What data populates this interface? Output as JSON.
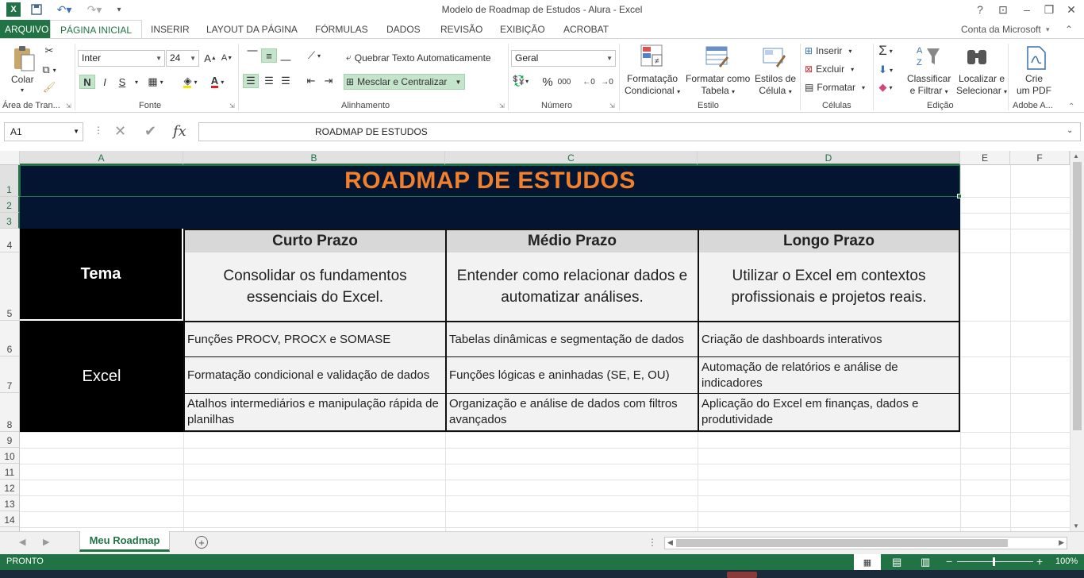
{
  "window": {
    "title": "Modelo de Roadmap de Estudos - Alura - Excel",
    "help": "?",
    "account": "Conta da Microsoft"
  },
  "tabs": [
    "ARQUIVO",
    "PÁGINA INICIAL",
    "INSERIR",
    "LAYOUT DA PÁGINA",
    "FÓRMULAS",
    "DADOS",
    "REVISÃO",
    "EXIBIÇÃO",
    "ACROBAT"
  ],
  "ribbon": {
    "clipboard": {
      "paste": "Colar",
      "group": "Área de Tran..."
    },
    "font": {
      "name": "Inter",
      "size": "24",
      "bold": "N",
      "italic": "I",
      "underline": "S",
      "group": "Fonte"
    },
    "alignment": {
      "wrap": "Quebrar Texto Automaticamente",
      "merge": "Mesclar e Centralizar",
      "group": "Alinhamento"
    },
    "number": {
      "format": "Geral",
      "percent": "%",
      "thousands": "000",
      "group": "Número"
    },
    "styles": {
      "cond1": "Formatação",
      "cond2": "Condicional",
      "table1": "Formatar como",
      "table2": "Tabela",
      "cell1": "Estilos de",
      "cell2": "Célula",
      "group": "Estilo"
    },
    "cells": {
      "insert": "Inserir",
      "delete": "Excluir",
      "format": "Formatar",
      "group": "Células"
    },
    "editing": {
      "sort1": "Classificar",
      "sort2": "e Filtrar",
      "find1": "Localizar e",
      "find2": "Selecionar",
      "group": "Edição"
    },
    "adobe": {
      "pdf1": "Crie",
      "pdf2": "um PDF",
      "group": "Adobe A..."
    }
  },
  "formula_bar": {
    "name_box": "A1",
    "fx": "fx",
    "content": "ROADMAP DE ESTUDOS"
  },
  "columns": [
    "A",
    "B",
    "C",
    "D",
    "E",
    "F"
  ],
  "rows": [
    "1",
    "2",
    "3",
    "4",
    "5",
    "6",
    "7",
    "8",
    "9",
    "10",
    "11",
    "12",
    "13",
    "14"
  ],
  "sheet": {
    "title": "ROADMAP DE ESTUDOS",
    "tema_label": "Tema",
    "headers": [
      "Curto Prazo",
      "Médio Prazo",
      "Longo Prazo"
    ],
    "descriptions": [
      "Consolidar os fundamentos essenciais do Excel.",
      "Entender como relacionar dados e automatizar análises.",
      "Utilizar o Excel em contextos profissionais e projetos reais."
    ],
    "theme": "Excel",
    "items": [
      [
        "Funções PROCV, PROCX e SOMASE",
        "Tabelas dinâmicas e segmentação de dados",
        "Criação de dashboards interativos"
      ],
      [
        "Formatação condicional e validação de dados",
        "Funções lógicas e aninhadas (SE, E, OU)",
        "Automação de relatórios e análise de indicadores"
      ],
      [
        "Atalhos intermediários e manipulação rápida de planilhas",
        "Organização e análise de dados com filtros avançados",
        "Aplicação do Excel em finanças, dados e produtividade"
      ]
    ]
  },
  "sheet_tab": "Meu Roadmap",
  "status": {
    "mode": "PRONTO",
    "zoom": "100%"
  }
}
